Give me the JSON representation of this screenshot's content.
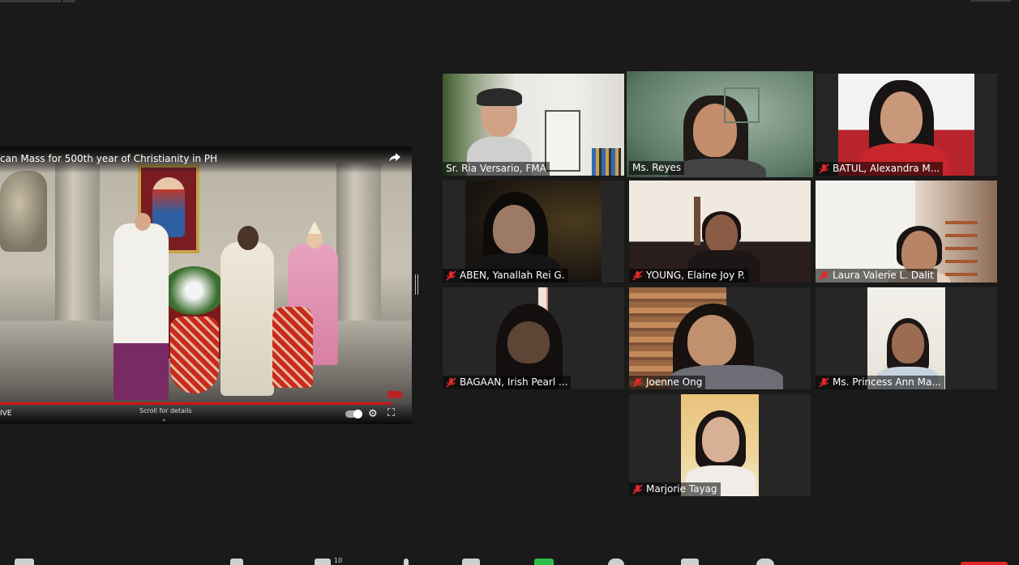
{
  "share": {
    "video_title": "can Mass for 500th year of Christianity in PH",
    "live_label": "IVE",
    "scroll_label": "Scroll for details",
    "scroll_chevron": "⌄",
    "gear_glyph": "⚙",
    "exit_fullscreen_glyph": "⛶"
  },
  "participants": [
    {
      "name": "Sr. Ria Versario, FMA",
      "muted": false,
      "active": false
    },
    {
      "name": "Ms. Reyes",
      "muted": false,
      "active": true
    },
    {
      "name": "BATUL, Alexandra M...",
      "muted": true,
      "active": false
    },
    {
      "name": "ABEN, Yanallah Rei G.",
      "muted": true,
      "active": false
    },
    {
      "name": "YOUNG, Elaine Joy P.",
      "muted": true,
      "active": false
    },
    {
      "name": "Laura Valerie L. Dalit",
      "muted": true,
      "active": false
    },
    {
      "name": "BAGAAN, Irish Pearl ...",
      "muted": true,
      "active": false
    },
    {
      "name": "Joenne Ong",
      "muted": true,
      "active": false
    },
    {
      "name": "Ms. Princess Ann Ma...",
      "muted": true,
      "active": false
    },
    {
      "name": "Marjorie Tayag",
      "muted": true,
      "active": false
    }
  ],
  "toolbar": {
    "participants_count": "10"
  },
  "colors": {
    "active_speaker": "#e8e77a",
    "muted_red": "#e02828",
    "progress_red": "#d01414"
  },
  "icons": {
    "mute": "microphone-muted-icon",
    "share": "share-arrow-icon",
    "settings": "gear-icon",
    "exit_fullscreen": "exit-fullscreen-icon"
  }
}
